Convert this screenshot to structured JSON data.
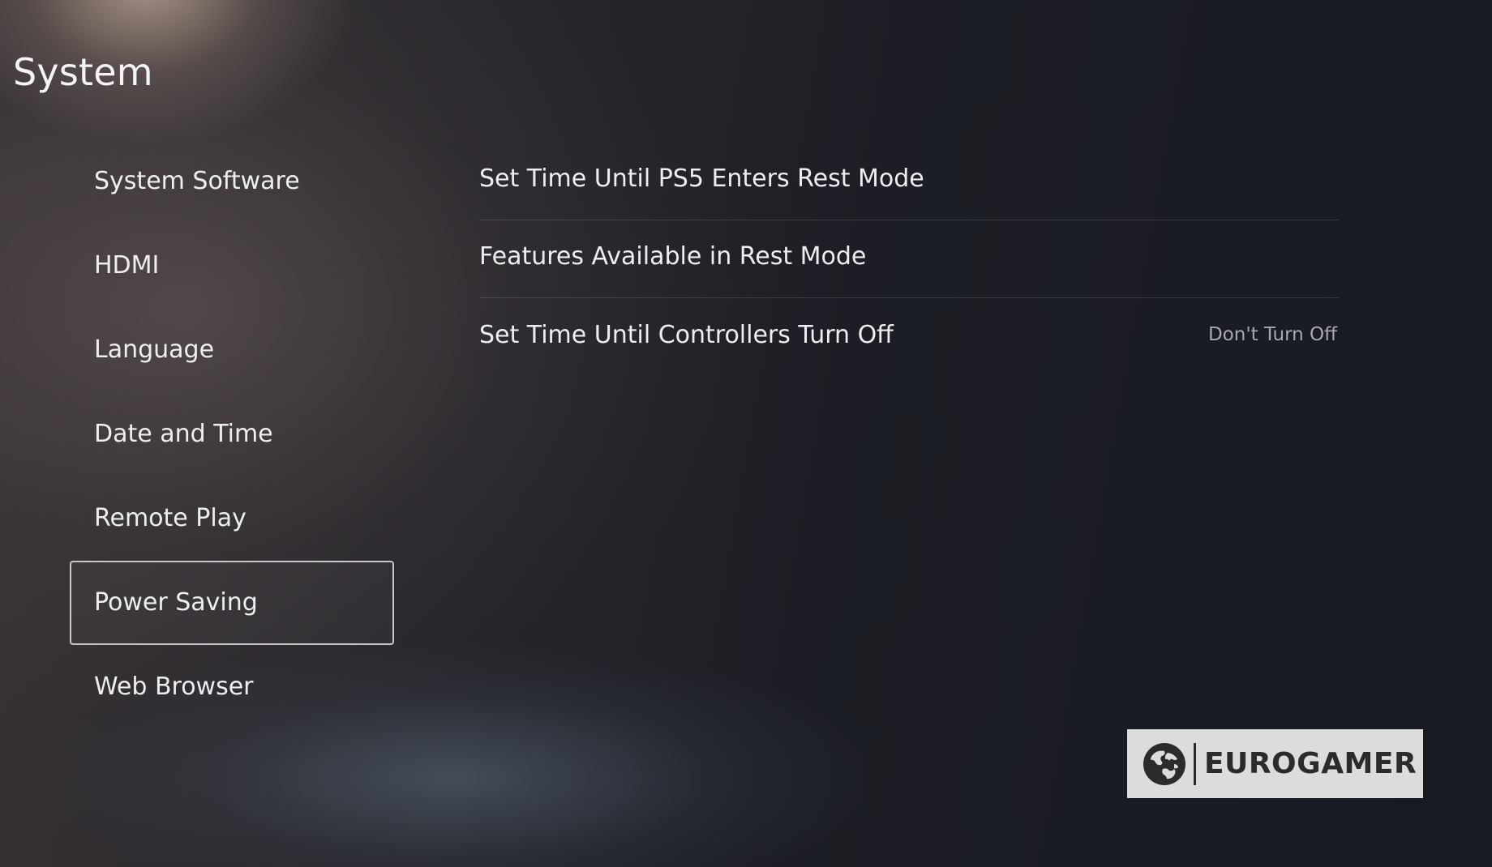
{
  "header": {
    "title": "System"
  },
  "sidebar": {
    "items": [
      {
        "label": "System Software",
        "selected": false
      },
      {
        "label": "HDMI",
        "selected": false
      },
      {
        "label": "Language",
        "selected": false
      },
      {
        "label": "Date and Time",
        "selected": false
      },
      {
        "label": "Remote Play",
        "selected": false
      },
      {
        "label": "Power Saving",
        "selected": true
      },
      {
        "label": "Web Browser",
        "selected": false
      }
    ]
  },
  "main": {
    "settings": [
      {
        "label": "Set Time Until PS5 Enters Rest Mode",
        "value": ""
      },
      {
        "label": "Features Available in Rest Mode",
        "value": ""
      },
      {
        "label": "Set Time Until Controllers Turn Off",
        "value": "Don't Turn Off"
      }
    ]
  },
  "watermark": {
    "text": "EUROGAMER",
    "icon": "globe-icon"
  },
  "colors": {
    "selection_border": "#c9c7cc",
    "text_primary": "#eeeef1",
    "text_secondary": "#a9a8ae",
    "watermark_bg": "#dcdcdc"
  }
}
